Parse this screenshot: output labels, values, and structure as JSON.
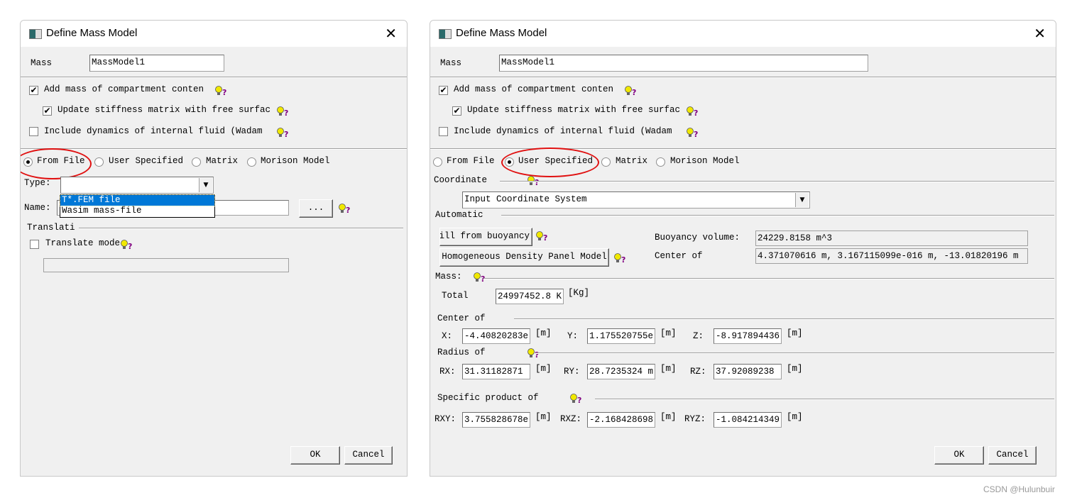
{
  "left": {
    "title": "Define Mass Model",
    "mass_label": "Mass",
    "mass_value": "MassModel1",
    "check_add": "Add mass of compartment conten",
    "check_update": "Update stiffness matrix with free surfac",
    "check_include": "Include dynamics of internal fluid (Wadam",
    "radios": [
      "From File",
      "User Specified",
      "Matrix",
      "Morison Model"
    ],
    "selected_radio": "From File",
    "type_label": "Type:",
    "type_value": "",
    "type_options": [
      "T*.FEM file",
      "Wasim mass-file"
    ],
    "name_label": "Name:",
    "name_value": "",
    "browse": "...",
    "translation_group": "Translati",
    "translate_check": "Translate mode",
    "ok": "OK",
    "cancel": "Cancel"
  },
  "right": {
    "title": "Define Mass Model",
    "mass_label": "Mass",
    "mass_value": "MassModel1",
    "check_add": "Add mass of compartment conten",
    "check_update": "Update stiffness matrix with free surfac",
    "check_include": "Include dynamics of internal fluid (Wadam",
    "radios": [
      "From File",
      "User Specified",
      "Matrix",
      "Morison Model"
    ],
    "selected_radio": "User Specified",
    "coordinate_label": "Coordinate",
    "coordinate_value": "Input Coordinate System",
    "automatic_label": "Automatic",
    "fill_button": "Fill from buoyancy",
    "homog_button": "Homogeneous Density Panel Model",
    "buoyancy_label": "Buoyancy volume:",
    "buoyancy_value": "24229.8158 m^3",
    "center_label": "Center of",
    "center_value": "4.371070616 m, 3.167115099e-016 m, -13.01820196 m",
    "mass_group": "Mass:",
    "total_label": "Total",
    "total_value": "24997452.8 K",
    "total_unit": "[Kg]",
    "cog_group": "Center of",
    "cog": [
      {
        "label": "X:",
        "value": "-4.40820283e",
        "unit": "[m]"
      },
      {
        "label": "Y:",
        "value": "1.175520755e",
        "unit": "[m]"
      },
      {
        "label": "Z:",
        "value": "-8.917894436",
        "unit": "[m]"
      }
    ],
    "radius_group": "Radius of",
    "radius": [
      {
        "label": "RX:",
        "value": "31.31182871",
        "unit": "[m]"
      },
      {
        "label": "RY:",
        "value": "28.7235324 m",
        "unit": "[m]"
      },
      {
        "label": "RZ:",
        "value": "37.92089238",
        "unit": "[m]"
      }
    ],
    "product_group": "Specific product of",
    "product": [
      {
        "label": "RXY:",
        "value": "3.755828678e",
        "unit": "[m]"
      },
      {
        "label": "RXZ:",
        "value": "-2.168428698",
        "unit": "[m]"
      },
      {
        "label": "RYZ:",
        "value": "-1.084214349",
        "unit": "[m]"
      }
    ],
    "ok": "OK",
    "cancel": "Cancel"
  },
  "watermark": "CSDN @Hulunbuir",
  "colors": {
    "highlight": "#0078d7",
    "annotation_ellipse": "#e01010",
    "bulb": "#f0e000",
    "question": "#800080"
  }
}
